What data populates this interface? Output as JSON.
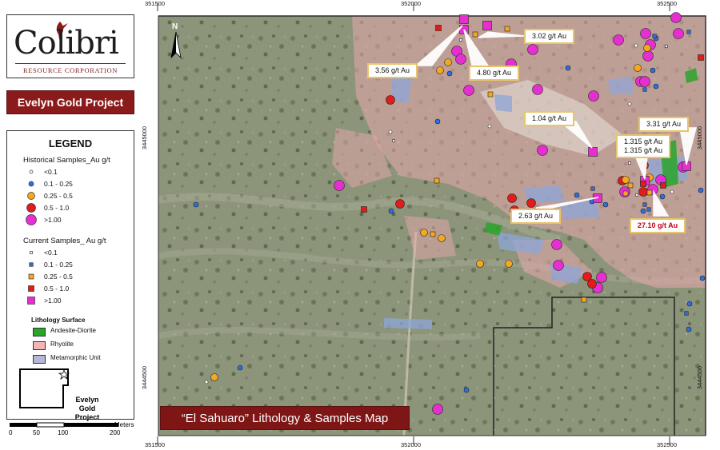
{
  "logo": {
    "wordmark": "Colibri",
    "tagline": "RESOURCE CORPORATION"
  },
  "project_banner": "Evelyn Gold Project",
  "legend": {
    "title": "LEGEND",
    "historical_heading": "Historical Samples_Au g/t",
    "historical_classes": [
      "<0.1",
      "0.1 - 0.25",
      "0.25 - 0.5",
      "0.5 - 1.0",
      ">1.00"
    ],
    "current_heading": "Current Samples_ Au g/t",
    "current_classes": [
      "<0.1",
      "0.1 - 0.25",
      "0.25 - 0.5",
      "0.5 - 1.0",
      ">1.00"
    ],
    "lithology_heading": "Lithology Surface",
    "lithology_classes": [
      "Andesite-Diorite",
      "Rhyolite",
      "Metamorphic Unit"
    ],
    "class_colors": [
      "#ffffff",
      "#2f6ee0",
      "#f4a81e",
      "#e21b1b",
      "#e62fd0"
    ],
    "lithology_colors": [
      "#2aa52a",
      "#f2b5b5",
      "#b4b8d6"
    ]
  },
  "inset": {
    "label": "Evelyn Gold Project"
  },
  "scale_bar": {
    "ticks": [
      "0",
      "50",
      "100",
      "200"
    ],
    "unit": "Meters"
  },
  "map_title": "“El Sahuaro” Lithology & Samples Map",
  "north_label": "N",
  "grid": {
    "x_labels": [
      "351500",
      "352000",
      "352500"
    ],
    "y_labels": [
      "3445000",
      "3444500"
    ]
  },
  "callouts": [
    {
      "text": "3.02 g/t Au"
    },
    {
      "text": "3.56 g/t Au"
    },
    {
      "text": "4.80 g/t Au"
    },
    {
      "text": "1.04 g/t Au"
    },
    {
      "text": "3.31 g/t Au"
    },
    {
      "text": "1.315 g/t Au"
    },
    {
      "text": "1.315 g/t Au"
    },
    {
      "text": "2.63 g/t Au"
    },
    {
      "text": "27.10 g/t Au"
    }
  ]
}
